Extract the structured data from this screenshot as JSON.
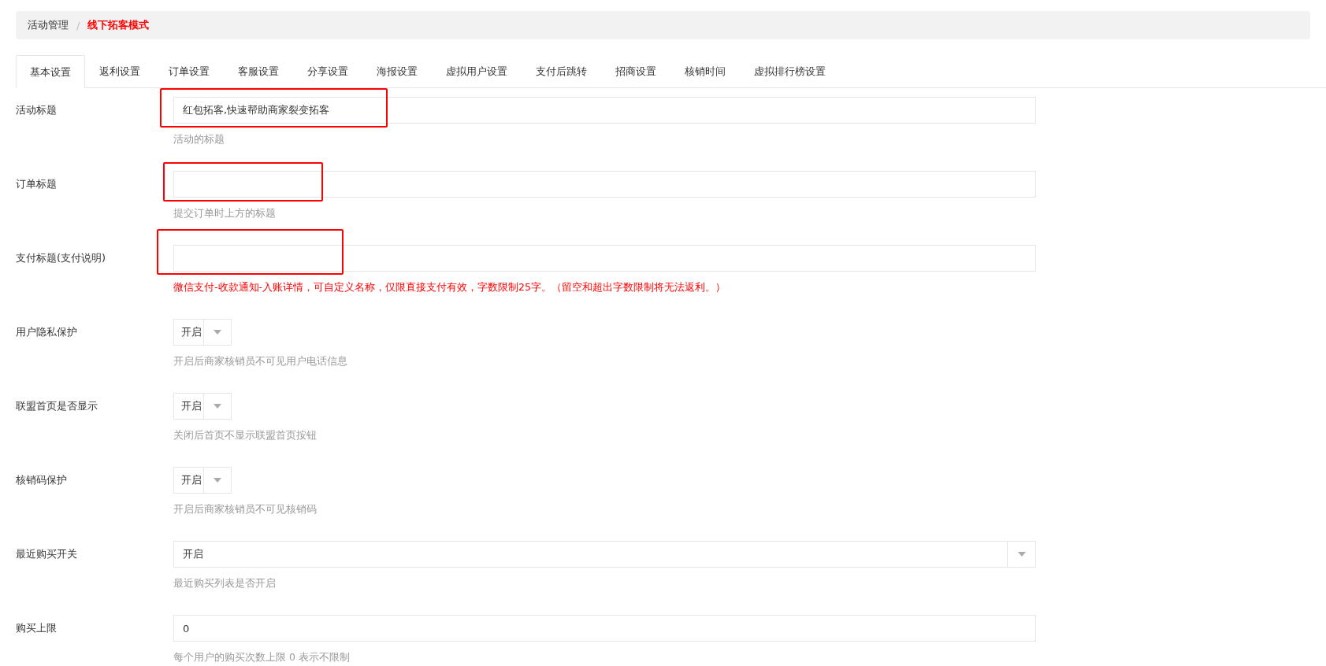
{
  "breadcrumb_separator": "/",
  "breadcrumb": [
    {
      "label": "活动管理",
      "current": false
    },
    {
      "label": "线下拓客模式",
      "current": true
    }
  ],
  "tabs": [
    {
      "label": "基本设置",
      "selected": true
    },
    {
      "label": "返利设置",
      "selected": false
    },
    {
      "label": "订单设置",
      "selected": false
    },
    {
      "label": "客服设置",
      "selected": false
    },
    {
      "label": "分享设置",
      "selected": false
    },
    {
      "label": "海报设置",
      "selected": false
    },
    {
      "label": "虚拟用户设置",
      "selected": false
    },
    {
      "label": "支付后跳转",
      "selected": false
    },
    {
      "label": "招商设置",
      "selected": false
    },
    {
      "label": "核销时间",
      "selected": false
    },
    {
      "label": "虚拟排行榜设置",
      "selected": false
    }
  ],
  "fields": [
    {
      "label": "活动标题",
      "kind": "text",
      "value": "红包拓客,快速帮助商家裂变拓客",
      "hint": "活动的标题",
      "hint_warning": false,
      "highlighted": true
    },
    {
      "label": "订单标题",
      "kind": "text",
      "hint": "提交订单时上方的标题",
      "hint_warning": false,
      "highlighted": true
    },
    {
      "label": "支付标题(支付说明)",
      "kind": "text",
      "hint": "微信支付-收款通知-入账详情，可自定义名称，仅限直接支付有效，字数限制25字。（留空和超出字数限制将无法返利。）",
      "hint_warning": true,
      "highlighted": true
    },
    {
      "label": "用户隐私保护",
      "kind": "switch-select",
      "value": "开启",
      "hint": "开启后商家核销员不可见用户电话信息",
      "hint_warning": false,
      "highlighted": false
    },
    {
      "label": "联盟首页是否显示",
      "kind": "switch-select",
      "value": "开启",
      "hint": "关闭后首页不显示联盟首页按钮",
      "hint_warning": false,
      "highlighted": false
    },
    {
      "label": "核销码保护",
      "kind": "switch-select",
      "value": "开启",
      "hint": "开启后商家核销员不可见核销码",
      "hint_warning": false,
      "highlighted": false
    },
    {
      "label": "最近购买开关",
      "kind": "select",
      "value": "开启",
      "hint": "最近购买列表是否开启",
      "hint_warning": false,
      "highlighted": false
    },
    {
      "label": "购买上限",
      "kind": "text",
      "value": "0",
      "hint": "每个用户的购买次数上限 0 表示不限制",
      "hint_warning": false,
      "highlighted": false
    }
  ]
}
